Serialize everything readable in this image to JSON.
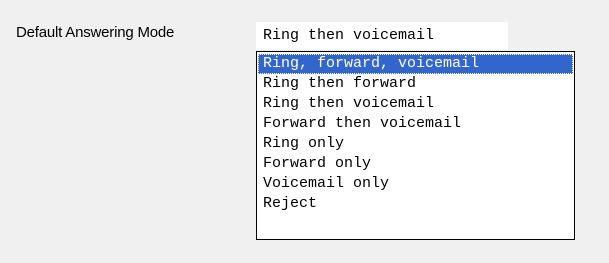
{
  "form": {
    "answering_mode_label": "Default Answering Mode"
  },
  "select": {
    "selected_value": "Ring then voicemail",
    "highlighted_index": 0,
    "options": [
      "Ring, forward, voicemail",
      "Ring then forward",
      "Ring then voicemail",
      "Forward then voicemail",
      "Ring only",
      "Forward only",
      "Voicemail only",
      "Reject"
    ]
  },
  "colors": {
    "background": "#f0f0f0",
    "highlight": "#3366cc",
    "highlight_text": "#ffffff",
    "list_border": "#000000"
  }
}
